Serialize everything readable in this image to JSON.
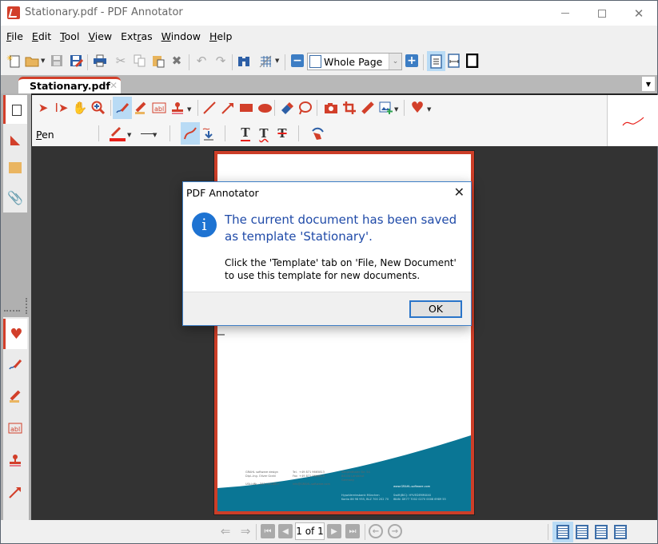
{
  "window": {
    "title": "Stationary.pdf - PDF Annotator",
    "controls": {
      "minimize": "minimize",
      "maximize": "maximize",
      "close": "✕"
    }
  },
  "menu": {
    "items": [
      {
        "label": "File",
        "mnemonic": "F"
      },
      {
        "label": "Edit",
        "mnemonic": "E"
      },
      {
        "label": "Tool",
        "mnemonic": "T"
      },
      {
        "label": "View",
        "mnemonic": "V"
      },
      {
        "label": "Extras",
        "mnemonic": "r"
      },
      {
        "label": "Window",
        "mnemonic": "W"
      },
      {
        "label": "Help",
        "mnemonic": "H"
      }
    ]
  },
  "toolbar": {
    "zoom_value": "Whole Page",
    "buttons": [
      "new-document",
      "open",
      "save",
      "save-as",
      "print",
      "cut",
      "copy",
      "paste",
      "delete",
      "undo",
      "redo",
      "find",
      "grid",
      "zoom-out",
      "zoom-in",
      "fit-page",
      "fit-width",
      "full-screen"
    ]
  },
  "tabs": {
    "document_tab": "Stationary.pdf",
    "close_glyph": "✕"
  },
  "tool_panel": {
    "current_tool_label": "Pen",
    "current_tool_mnemonic": "P",
    "pen_color": "#e8201a",
    "row1_tools": [
      "select",
      "text-select",
      "hand",
      "zoom",
      "pen",
      "highlighter",
      "text-box",
      "stamp",
      "line",
      "arrow",
      "rectangle",
      "ellipse",
      "eraser",
      "lasso",
      "snapshot",
      "crop",
      "ruler",
      "insert-image",
      "favorites"
    ],
    "row2_tools": [
      "color",
      "line-style",
      "smooth",
      "auto-save",
      "underline",
      "squiggly",
      "strikeout",
      "hand-eraser"
    ]
  },
  "sidebar": {
    "tabs": [
      "pages",
      "bookmarks",
      "notes",
      "attachments"
    ],
    "tool_tabs": [
      "favorites",
      "pen",
      "highlighter",
      "text-box",
      "stamp",
      "arrow"
    ]
  },
  "page": {
    "footer_left": [
      "GRAHL software design",
      "Dipl.-Ing. Oliver Grahl",
      "",
      "USt-IdNr.: DE211518817"
    ],
    "footer_mid": [
      "Tel.  +49 871 9665813",
      "Fax  +49 871 9665818",
      "",
      "info@GRAHL-software.com"
    ],
    "footer_right": [
      "Seligenthaler Str. 54",
      "84034 Landshut",
      "Germany"
    ],
    "footer_web": "www.GRAHL-software.com",
    "footer_bank": [
      "HypoVereinsbank München",
      "Konto 86 98 955, BLZ 700 202 70"
    ],
    "footer_iban": [
      "Swift(BIC): HYVEDEMMXXX",
      "IBAN: DE77 7002 0270 0008 6989 55"
    ],
    "accent": "#0a7695",
    "frame_color": "#cc3e28"
  },
  "statusbar": {
    "page_indicator": "1 of 1",
    "view_modes": [
      "single-page",
      "continuous",
      "two-page",
      "two-page-continuous"
    ]
  },
  "dialog": {
    "title": "PDF Annotator",
    "close_glyph": "✕",
    "icon_glyph": "i",
    "main_message": "The current document has been saved as template 'Stationary'.",
    "detail_message": "Click the 'Template' tab on 'File, New Document' to use this template for new documents.",
    "ok_label": "OK"
  }
}
